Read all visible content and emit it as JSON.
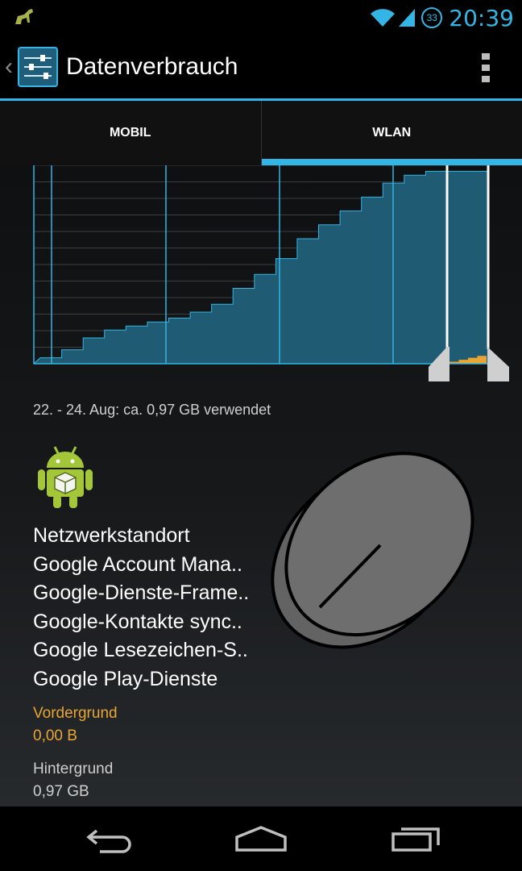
{
  "status": {
    "time": "20:39",
    "battery": "33",
    "icons": [
      "lizard-notification-icon",
      "wifi-icon",
      "signal-icon",
      "battery-icon"
    ]
  },
  "actionbar": {
    "title": "Datenverbrauch",
    "app_icon": "settings-sliders-icon",
    "back_icon": "back-caret-icon",
    "menu_icon": "overflow-menu-icon"
  },
  "tabs": [
    {
      "label": "MOBIL",
      "active": false
    },
    {
      "label": "WLAN",
      "active": true
    }
  ],
  "usage": {
    "summary": "22. - 24. Aug: ca. 0,97 GB verwendet"
  },
  "app_detail": {
    "icon": "android-package-icon",
    "apps": [
      "Netzwerkstandort",
      "Google Account Mana..",
      "Google-Dienste-Frame..",
      "Google-Kontakte sync..",
      "Google Lesezeichen-S..",
      "Google Play-Dienste"
    ],
    "foreground_label": "Vordergrund",
    "foreground_value": "0,00 B",
    "background_label": "Hintergrund",
    "background_value": "0,97 GB",
    "pie": {
      "foreground_fraction": 0.0,
      "background_fraction": 1.0
    }
  },
  "chart_data": {
    "type": "area",
    "series": [
      {
        "values": [
          0.03,
          0.07,
          0.13,
          0.17,
          0.19,
          0.21,
          0.23,
          0.26,
          0.3,
          0.38,
          0.45,
          0.53,
          0.63,
          0.7,
          0.77,
          0.84,
          0.91,
          0.95,
          0.97
        ]
      }
    ],
    "selected_range_values": [
      0.01,
      0.02,
      0.03,
      0.04
    ],
    "colors": {
      "area": "#1f5b73",
      "line": "#33b5e5",
      "selected": "#e8a534",
      "grid": "#3a3f44"
    }
  },
  "navbar": {
    "buttons": [
      "back-icon",
      "home-icon",
      "recents-icon"
    ]
  },
  "colors": {
    "accent": "#33b5e5",
    "orange": "#e8a534"
  }
}
